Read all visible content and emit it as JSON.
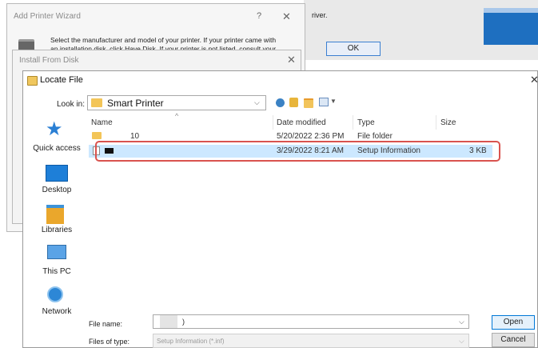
{
  "bg_dialog": {
    "ok_label": "OK",
    "snippet": "river."
  },
  "wizard": {
    "title": "Add Printer Wizard",
    "help_label": "?",
    "close_label": "✕",
    "line1": "Select the manufacturer and model of your printer. If your printer came with",
    "line2": "an installation disk, click Have Disk. If your printer is not listed, consult your"
  },
  "install_disk": {
    "title": "Install From Disk",
    "close_label": "✕"
  },
  "locate": {
    "title": "Locate File",
    "close_label": "✕",
    "lookin_label": "Look in:",
    "lookin_value": "Smart Printer",
    "nav": [
      "Quick access",
      "Desktop",
      "Libraries",
      "This PC",
      "Network"
    ],
    "columns": [
      "Name",
      "Date modified",
      "Type",
      "Size"
    ],
    "rows": [
      {
        "name": "10",
        "date": "5/20/2022 2:36 PM",
        "type": "File folder",
        "size": ""
      },
      {
        "name": "",
        "date": "3/29/2022 8:21 AM",
        "type": "Setup Information",
        "size": "3 KB"
      }
    ],
    "filename_label": "File name:",
    "filename_value": ")",
    "filetype_label": "Files of type:",
    "filetype_value": "Setup Information (*.inf)",
    "open_label": "Open",
    "cancel_label": "Cancel"
  },
  "colors": {
    "highlight": "#cce8ff",
    "annotation": "#d9534f",
    "accent": "#0078d7"
  }
}
